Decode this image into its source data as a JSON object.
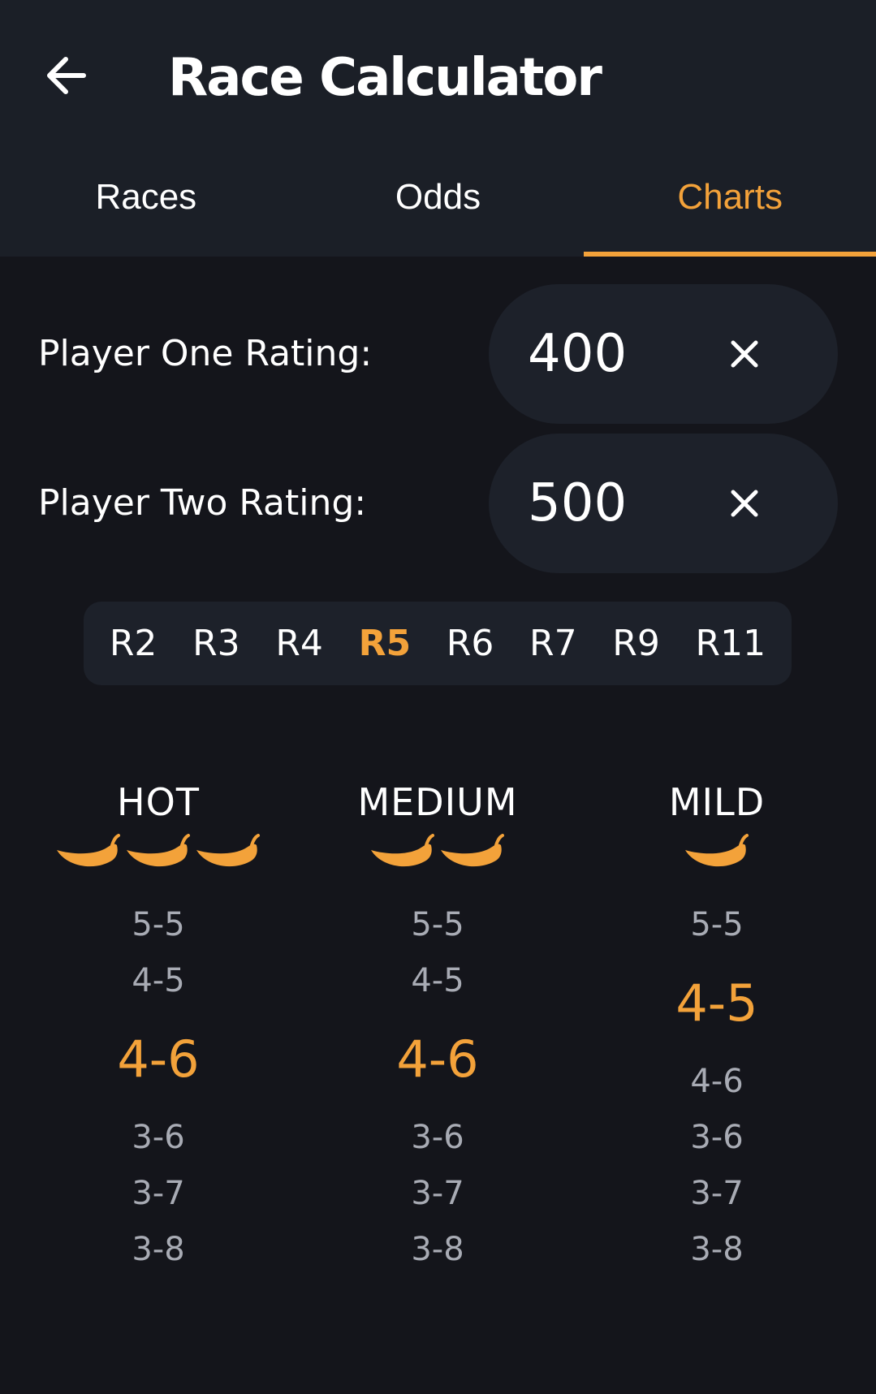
{
  "header": {
    "title": "Race Calculator",
    "back_icon": "arrow-left-icon"
  },
  "tabs": [
    {
      "label": "Races",
      "active": false
    },
    {
      "label": "Odds",
      "active": false
    },
    {
      "label": "Charts",
      "active": true
    }
  ],
  "ratings": {
    "player_one": {
      "label": "Player One Rating:",
      "value": "400"
    },
    "player_two": {
      "label": "Player Two Rating:",
      "value": "500"
    }
  },
  "races": {
    "items": [
      "R2",
      "R3",
      "R4",
      "R5",
      "R6",
      "R7",
      "R9",
      "R11"
    ],
    "selected": "R5"
  },
  "heat_levels": [
    {
      "name": "HOT",
      "peppers": 3,
      "odds": [
        "5-5",
        "4-5",
        "4-6",
        "3-6",
        "3-7",
        "3-8"
      ],
      "highlighted": "4-6"
    },
    {
      "name": "MEDIUM",
      "peppers": 2,
      "odds": [
        "5-5",
        "4-5",
        "4-6",
        "3-6",
        "3-7",
        "3-8"
      ],
      "highlighted": "4-6"
    },
    {
      "name": "MILD",
      "peppers": 1,
      "odds": [
        "5-5",
        "4-5",
        "4-6",
        "3-6",
        "3-7",
        "3-8"
      ],
      "highlighted": "4-5"
    }
  ],
  "colors": {
    "accent": "#f3a23a",
    "background": "#14151b",
    "surface": "#1b1f27",
    "field": "#1d212a",
    "muted_text": "#a8abb4"
  }
}
